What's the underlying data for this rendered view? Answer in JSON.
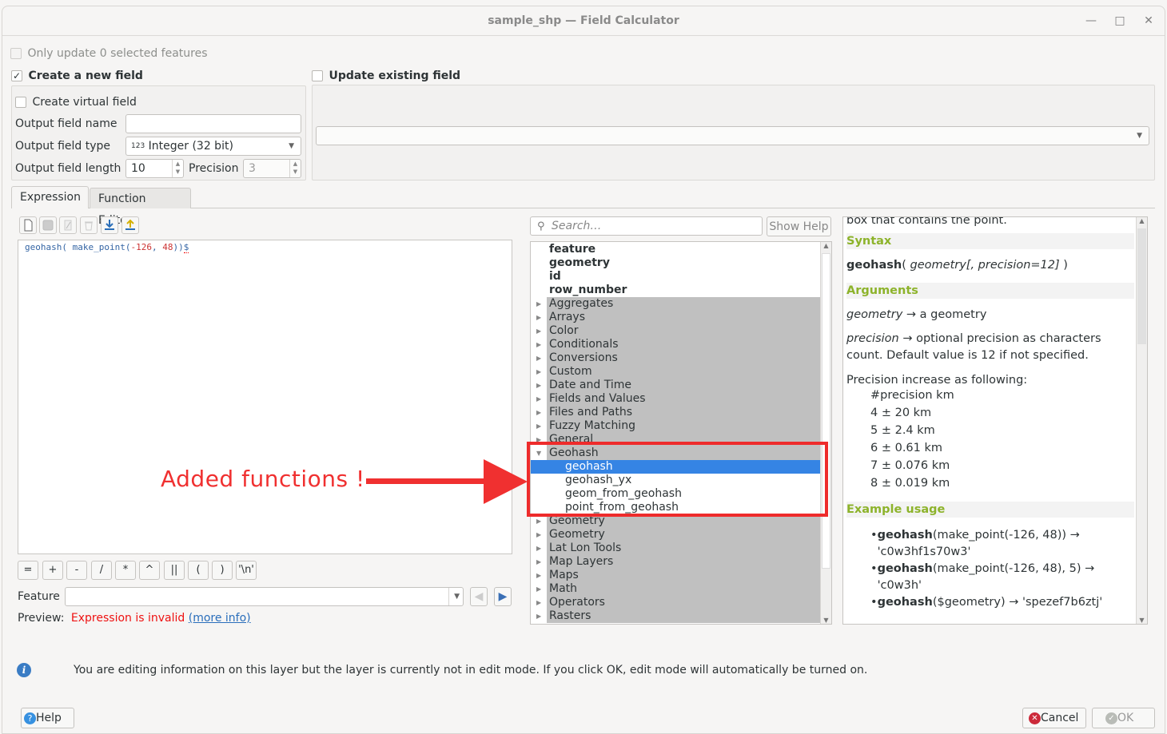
{
  "window": {
    "title": "sample_shp — Field Calculator",
    "controls": [
      "minimize",
      "maximize",
      "close"
    ]
  },
  "top": {
    "only_update_selected": {
      "label": "Only update 0 selected features",
      "checked": false,
      "enabled": false
    },
    "create_new_field": {
      "label": "Create a new field",
      "checked": true
    },
    "update_existing_field": {
      "label": "Update existing field",
      "checked": false,
      "combo_value": ""
    }
  },
  "new_field": {
    "create_virtual": {
      "label": "Create virtual field",
      "checked": false
    },
    "output_name": {
      "label": "Output field name",
      "value": ""
    },
    "output_type": {
      "label": "Output field type",
      "icon_text": "123",
      "value": "Integer (32 bit)"
    },
    "output_length": {
      "label": "Output field length",
      "value": "10"
    },
    "precision": {
      "label": "Precision",
      "value": "3"
    }
  },
  "tabs": [
    {
      "label": "Expression",
      "active": true
    },
    {
      "label": "Function Editor",
      "active": false
    }
  ],
  "editor_toolbar": {
    "icons": [
      "new-file-icon",
      "save-icon",
      "edit-icon",
      "delete-icon",
      "import-icon",
      "export-icon"
    ]
  },
  "expression": {
    "fn1": "geohash",
    "p1": "( ",
    "fn2": "make_point",
    "p2": "(",
    "n1": "-126",
    "p3": ", ",
    "n2": "48",
    "p4": "))",
    "trail": "$"
  },
  "operators": [
    "=",
    "+",
    "-",
    "/",
    "*",
    "^",
    "||",
    "(",
    ")",
    "'\\n'"
  ],
  "feature": {
    "label": "Feature",
    "value": ""
  },
  "preview": {
    "label": "Preview:",
    "error": "Expression is invalid",
    "link": "(more info)"
  },
  "search": {
    "placeholder": "Search…",
    "show_help": "Show Help"
  },
  "tree": {
    "bold_items": [
      "feature",
      "geometry",
      "id",
      "row_number"
    ],
    "groups_before": [
      "Aggregates",
      "Arrays",
      "Color",
      "Conditionals",
      "Conversions",
      "Custom",
      "Date and Time",
      "Fields and Values",
      "Files and Paths",
      "Fuzzy Matching",
      "General"
    ],
    "expanded_group": "Geohash",
    "expanded_children": [
      "geohash",
      "geohash_yx",
      "geom_from_geohash",
      "point_from_geohash"
    ],
    "selected_child": "geohash",
    "groups_after": [
      "Geometry",
      "Geometry",
      "Lat Lon Tools",
      "Map Layers",
      "Maps",
      "Math",
      "Operators",
      "Rasters"
    ]
  },
  "help": {
    "intro_tail": "box that contains the point.",
    "syntax_heading": "Syntax",
    "syntax_fn": "geohash",
    "syntax_open": "( ",
    "syntax_args": "geometry[, precision=12]",
    "syntax_close": " )",
    "arguments_heading": "Arguments",
    "arg1_name": "geometry",
    "arg1_desc": " → a geometry",
    "arg2_name": "precision",
    "arg2_desc": " → optional precision as characters count. Default value is 12 if not specified.",
    "precision_intro": "Precision increase as following:",
    "precision_table": [
      "#precision km",
      "4 ± 20 km",
      "5 ± 2.4 km",
      "6 ± 0.61 km",
      "7 ± 0.076 km",
      "8 ± 0.019 km"
    ],
    "example_heading": "Example usage",
    "examples": [
      {
        "fn": "geohash",
        "rest": "(make_point(-126, 48)) → 'c0w3hf1s70w3'"
      },
      {
        "fn": "geohash",
        "rest": "(make_point(-126, 48), 5) → 'c0w3h'"
      },
      {
        "fn": "geohash",
        "rest": "($geometry) → 'spezef7b6ztj'"
      }
    ]
  },
  "info_message": "You are editing information on this layer but the layer is currently not in edit mode. If you click OK, edit mode will automatically be turned on.",
  "buttons": {
    "help": "Help",
    "cancel": "Cancel",
    "ok": "OK"
  },
  "annotation": {
    "text": "Added functions !",
    "color": "#f03030"
  }
}
